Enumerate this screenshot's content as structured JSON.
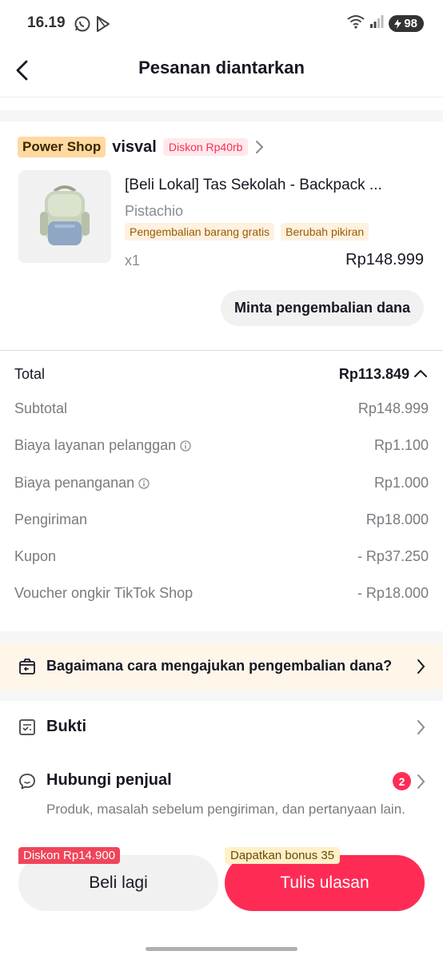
{
  "status_bar": {
    "time": "16.19",
    "battery": "98"
  },
  "header": {
    "title": "Pesanan diantarkan"
  },
  "store": {
    "power_badge": "Power Shop",
    "name": "visval",
    "discount": "Diskon Rp40rb"
  },
  "product": {
    "title": "[Beli Lokal] Tas Sekolah - Backpack ...",
    "variant": "Pistachio",
    "tags": [
      "Pengembalian barang gratis",
      "Berubah pikiran"
    ],
    "quantity": "x1",
    "price": "Rp148.999",
    "refund_button": "Minta pengembalian dana"
  },
  "summary": {
    "total_label": "Total",
    "total_value": "Rp113.849",
    "rows": [
      {
        "label": "Subtotal",
        "value": "Rp148.999",
        "info": false
      },
      {
        "label": "Biaya layanan pelanggan",
        "value": "Rp1.100",
        "info": true
      },
      {
        "label": "Biaya penanganan",
        "value": "Rp1.000",
        "info": true
      },
      {
        "label": "Pengiriman",
        "value": "Rp18.000",
        "info": false
      },
      {
        "label": "Kupon",
        "value": "- Rp37.250",
        "info": false
      },
      {
        "label": "Voucher ongkir TikTok Shop",
        "value": "- Rp18.000",
        "info": false
      }
    ]
  },
  "help_banner": {
    "text": "Bagaimana cara mengajukan pengembalian dana?"
  },
  "menu": {
    "proof": {
      "label": "Bukti"
    },
    "contact": {
      "label": "Hubungi penjual",
      "badge": "2",
      "description": "Produk, masalah sebelum pengiriman, dan pertanyaan lain."
    }
  },
  "actions": {
    "buy_again": "Beli lagi",
    "buy_again_promo": "Diskon Rp14.900",
    "write_review": "Tulis ulasan",
    "review_promo": "Dapatkan bonus 35"
  },
  "colors": {
    "accent": "#fe2c55",
    "power_badge": "#ffd9a0",
    "help_banner": "#fff6ea"
  },
  "icons": [
    "whatsapp-icon",
    "play-store-icon",
    "wifi-icon",
    "signal-icon",
    "back-arrow-icon",
    "chevron-right-icon",
    "chevron-up-icon",
    "info-icon",
    "return-box-icon",
    "proof-document-icon",
    "chat-bubble-icon"
  ]
}
